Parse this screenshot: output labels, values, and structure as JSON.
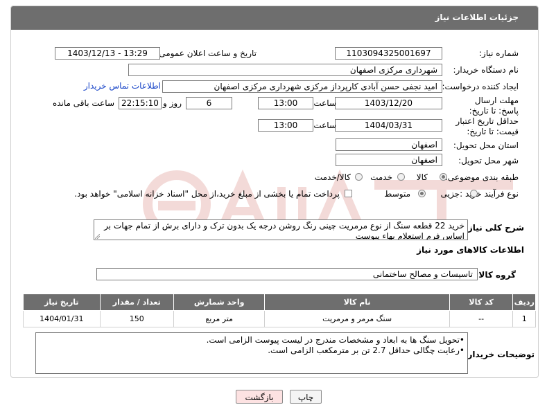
{
  "header": {
    "title": "جزئیات اطلاعات نیاز"
  },
  "fields": {
    "need_number_label": "شماره نیاز:",
    "need_number": "1103094325001697",
    "announce_label": "تاریخ و ساعت اعلان عمومی:",
    "announce_value": "1403/12/13 - 13:29",
    "buyer_org_label": "نام دستگاه خریدار:",
    "buyer_org": "شهرداری مرکزی اصفهان",
    "creator_label": "ایجاد کننده درخواست:",
    "creator": "امید نجفی حسن آبادی کارپرداز مرکزی شهرداری مرکزی اصفهان",
    "contact_link": "اطلاعات تماس خریدار",
    "deadline_label": "مهلت ارسال پاسخ: تا تاریخ:",
    "deadline_date": "1403/12/20",
    "time_label": "ساعت",
    "deadline_time": "13:00",
    "days_value": "6",
    "days_label": "روز و",
    "remaining_time": "22:15:10",
    "remaining_label": "ساعت باقی مانده",
    "validity_label": "حداقل تاریخ اعتبار قیمت: تا تاریخ:",
    "validity_date": "1404/03/31",
    "validity_time": "13:00",
    "province_label": "استان محل تحویل:",
    "province": "اصفهان",
    "city_label": "شهر محل تحویل:",
    "city": "اصفهان",
    "category_label": "طبقه بندی موضوعی:",
    "category_options": [
      "کالا",
      "خدمت",
      "کالا/خدمت"
    ],
    "process_label": "نوع فرآیند خرید :",
    "process_options": [
      "جزیی",
      "متوسط"
    ],
    "payment_text": "پرداخت تمام یا بخشی از مبلغ خرید،از محل \"اسناد خزانه اسلامی\" خواهد بود.",
    "general_desc_label": "شرح کلی نیاز:",
    "general_desc": "خرید 22 قطعه سنگ از نوع مرمریت چینی رنگ روشن درجه یک بدون ترک و دارای برش از تمام جهات بر اساس فرم استعلام بهاء پیوست"
  },
  "goods_section": {
    "title": "اطلاعات کالاهای مورد نیاز",
    "group_label": "گروه کالا:",
    "group_value": "تاسیسات و مصالح ساختمانی"
  },
  "table": {
    "headers": [
      "ردیف",
      "کد کالا",
      "نام کالا",
      "واحد شمارش",
      "تعداد / مقدار",
      "تاریخ نیاز"
    ],
    "rows": [
      [
        "1",
        "--",
        "سنگ مرمر و مرمریت",
        "متر مربع",
        "150",
        "1404/01/31"
      ]
    ]
  },
  "notes": {
    "label": "توضیحات خریدار:",
    "lines": [
      "•تحویل سنگ ها به ابعاد و مشخصات مندرج در لیست پیوست الزامی است.",
      "•رعایت چگالی حداقل 2.7 تن بر مترمکعب الزامی است."
    ]
  },
  "buttons": {
    "print": "چاپ",
    "back": "بازگشت"
  },
  "colors": {
    "header_bg": "#6e6e6e",
    "link": "#1a46c8",
    "back_button_bg": "#fde2e2",
    "watermark": "#c0392b"
  }
}
